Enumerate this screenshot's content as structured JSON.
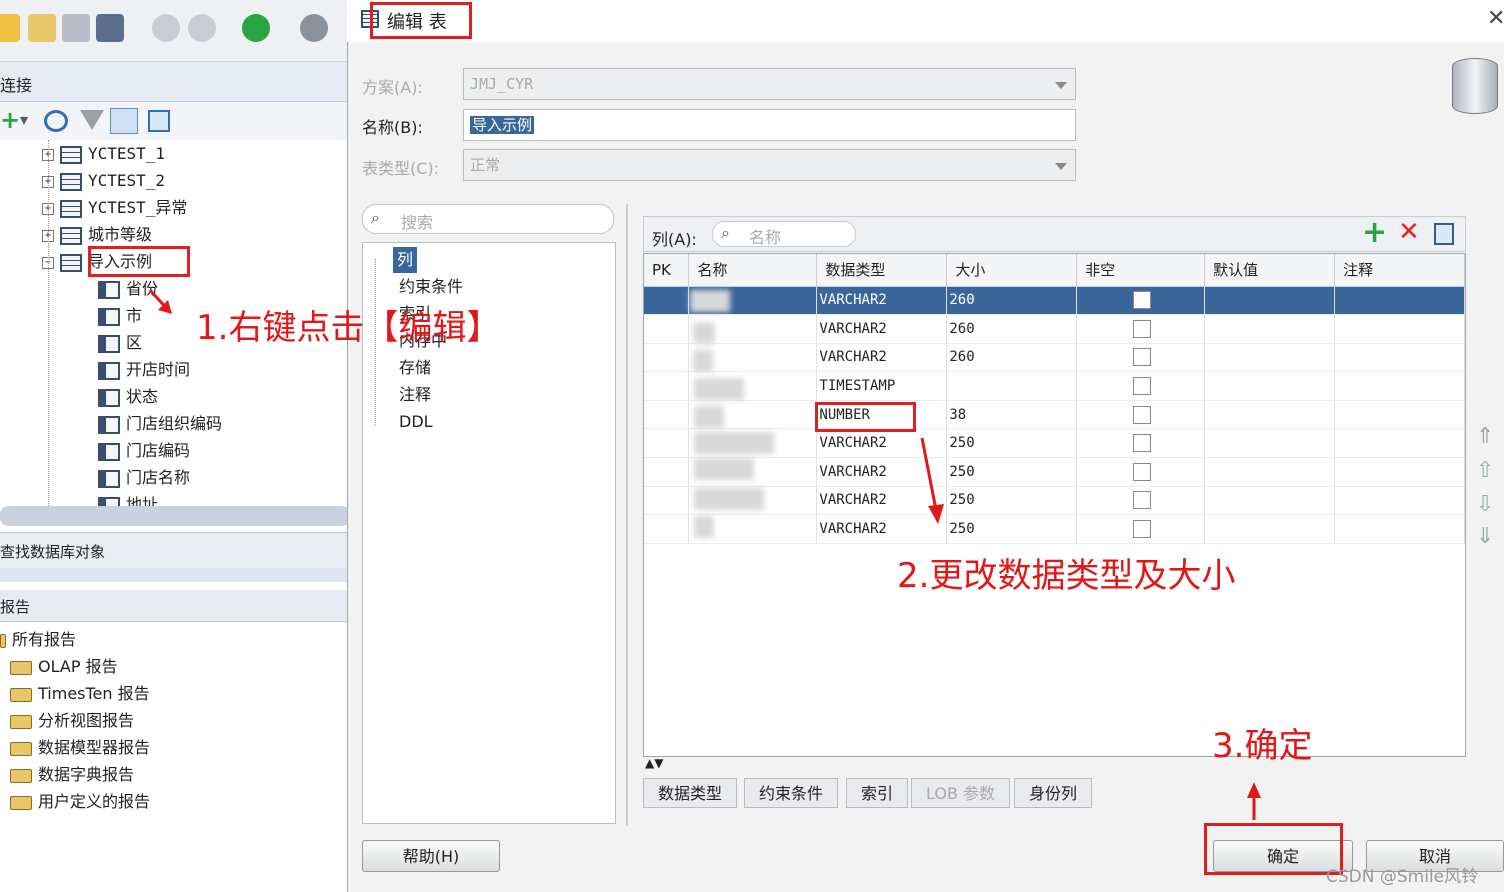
{
  "left": {
    "connections_title": "连接",
    "tree": [
      {
        "label": "YCTEST_1",
        "type": "table",
        "expander": "+"
      },
      {
        "label": "YCTEST_2",
        "type": "table",
        "expander": "+"
      },
      {
        "label": "YCTEST_异常",
        "type": "table",
        "expander": "+"
      },
      {
        "label": "城市等级",
        "type": "table",
        "expander": "+"
      },
      {
        "label": "导入示例",
        "type": "table",
        "expander": "−"
      },
      {
        "label": "省份",
        "type": "column"
      },
      {
        "label": "市",
        "type": "column"
      },
      {
        "label": "区",
        "type": "column"
      },
      {
        "label": "开店时间",
        "type": "column"
      },
      {
        "label": "状态",
        "type": "column"
      },
      {
        "label": "门店组织编码",
        "type": "column"
      },
      {
        "label": "门店编码",
        "type": "column"
      },
      {
        "label": "门店名称",
        "type": "column"
      },
      {
        "label": "地址",
        "type": "column"
      }
    ],
    "find_db_objects": "查找数据库对象",
    "reports_title": "报告",
    "reports": [
      "所有报告",
      "OLAP 报告",
      "TimesTen 报告",
      "分析视图报告",
      "数据模型器报告",
      "数据字典报告",
      "用户定义的报告"
    ]
  },
  "dialog": {
    "title": "编辑 表",
    "schema_label": "方案(A):",
    "schema_value": "JMJ_CYR",
    "name_label": "名称(B):",
    "name_value": "导入示例",
    "table_type_label": "表类型(C):",
    "table_type_value": "正常",
    "search_placeholder": "搜索",
    "nav": [
      "列",
      "约束条件",
      "索引",
      "内存中",
      "存储",
      "注释",
      "DDL"
    ],
    "columns_label": "列(A):",
    "columns_search_placeholder": "名称",
    "headers": [
      "PK",
      "名称",
      "数据类型",
      "大小",
      "非空",
      "默认值",
      "注释"
    ],
    "rows": [
      {
        "type": "VARCHAR2",
        "size": "260",
        "selected": true
      },
      {
        "type": "VARCHAR2",
        "size": "260"
      },
      {
        "type": "VARCHAR2",
        "size": "260"
      },
      {
        "type": "TIMESTAMP",
        "size": ""
      },
      {
        "type": "NUMBER",
        "size": "38"
      },
      {
        "type": "VARCHAR2",
        "size": "250"
      },
      {
        "type": "VARCHAR2",
        "size": "250"
      },
      {
        "type": "VARCHAR2",
        "size": "250"
      },
      {
        "type": "VARCHAR2",
        "size": "250"
      }
    ],
    "bottom_tabs": [
      "数据类型",
      "约束条件",
      "索引",
      "LOB 参数",
      "身份列"
    ],
    "help_button": "帮助(H)",
    "ok_button": "确定",
    "cancel_button": "取消"
  },
  "annotations": {
    "step1": "1.右键点击【编辑】",
    "step2": "2.更改数据类型及大小",
    "step3": "3.确定",
    "color": "#e21818"
  },
  "watermark": "CSDN @Smile风铃"
}
